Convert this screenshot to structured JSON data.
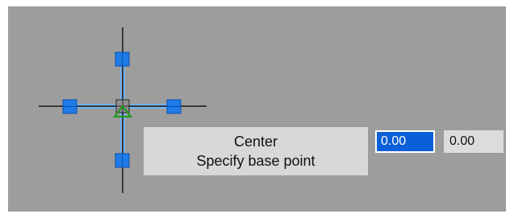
{
  "tooltip": {
    "line1": "Center",
    "line2": "Specify base point"
  },
  "coordinates": {
    "x_value": "0.00",
    "y_value": "0.00"
  },
  "icons": {
    "crosshair": "crosshair-cursor-icon",
    "grip": "grip-handle-icon",
    "base_point": "base-point-triangle-icon"
  },
  "colors": {
    "canvas": "#9d9d9d",
    "grip": "#1e7be8",
    "selection_line": "#6fb2f0",
    "crosshair": "#1a1a1a",
    "active_input": "#0a5fd6",
    "triangle": "#1a9a1a"
  }
}
